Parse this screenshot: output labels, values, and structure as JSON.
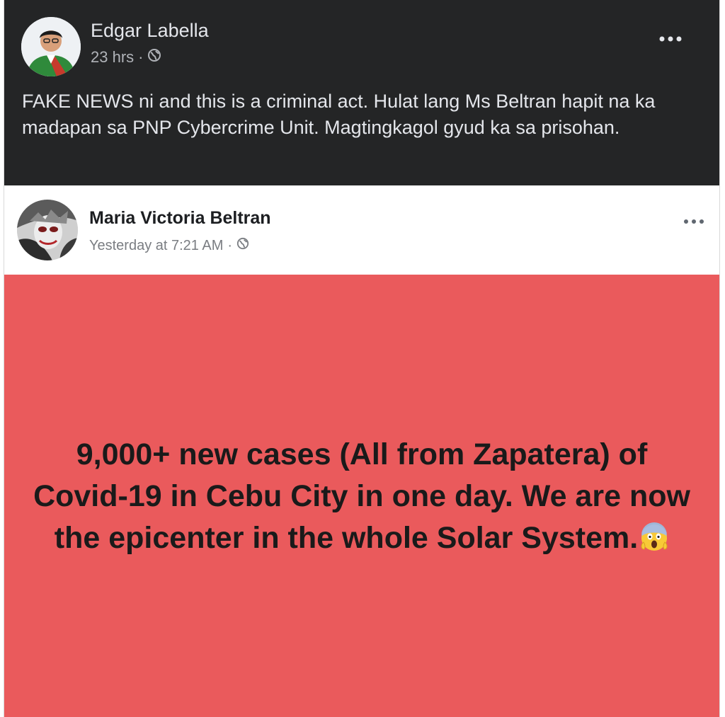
{
  "colors": {
    "dark_post_bg": "#242526",
    "dark_text": "#e4e6eb",
    "dark_meta": "#b0b3b8",
    "light_post_bg": "#ffffff",
    "post_background_red": "#ea5a5c",
    "post_text": "#1a1a1a"
  },
  "post_top": {
    "author": "Edgar Labella",
    "timestamp": "23 hrs",
    "separator": "·",
    "privacy_icon": "globe-icon",
    "more_icon": "more-options-icon",
    "text": "FAKE NEWS ni and this is a criminal act. Hulat lang Ms Beltran hapit na ka madapan sa PNP Cybercrime Unit. Magtingkagol gyud ka sa prisohan."
  },
  "post_shared": {
    "author": "Maria Victoria Beltran",
    "timestamp": "Yesterday at 7:21 AM",
    "separator": "·",
    "privacy_icon": "globe-icon",
    "more_icon": "more-options-icon",
    "text": "9,000+ new cases (All from Zapatera) of Covid-19 in Cebu City in one day. We are now the epicenter in the whole Solar System.",
    "emoji_icon": "screaming-face-emoji"
  }
}
